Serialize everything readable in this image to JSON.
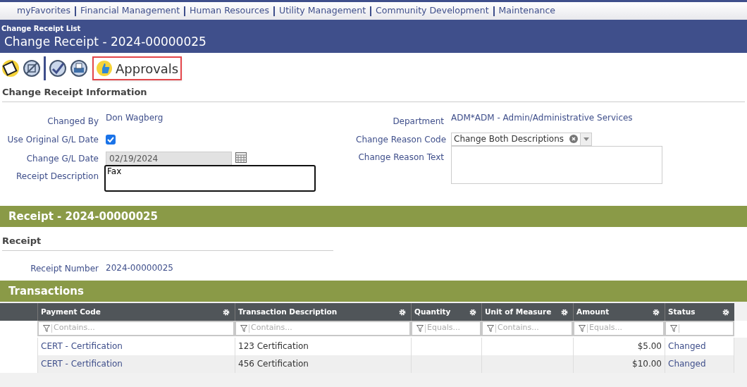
{
  "nav": [
    {
      "label": "myFavorites"
    },
    {
      "label": "Financial Management"
    },
    {
      "label": "Human Resources"
    },
    {
      "label": "Utility Management"
    },
    {
      "label": "Community Development"
    },
    {
      "label": "Maintenance"
    }
  ],
  "header": {
    "breadcrumb": "Change Receipt List",
    "title": "Change Receipt - 2024-00000025"
  },
  "toolbar": {
    "approvals_label": "Approvals"
  },
  "info": {
    "title": "Change Receipt Information",
    "changed_by": {
      "label": "Changed By",
      "value": "Don Wagberg"
    },
    "use_original_gl_date": {
      "label": "Use Original G/L Date",
      "checked": true
    },
    "change_gl_date": {
      "label": "Change G/L Date",
      "value": "02/19/2024",
      "disabled": true
    },
    "receipt_description": {
      "label": "Receipt Description",
      "value": "Fax"
    },
    "department": {
      "label": "Department",
      "value": "ADM*ADM - Admin/Administrative Services"
    },
    "change_reason_code": {
      "label": "Change Reason Code",
      "value": "Change Both Descriptions"
    },
    "change_reason_text": {
      "label": "Change Reason Text"
    }
  },
  "receipt_band": "Receipt - 2024-00000025",
  "receipt": {
    "title": "Receipt",
    "label": "Receipt Number",
    "value": "2024-00000025"
  },
  "transactions": {
    "title": "Transactions",
    "columns": [
      {
        "label": "Payment Code",
        "filter": "Contains..."
      },
      {
        "label": "Transaction Description",
        "filter": "Contains..."
      },
      {
        "label": "Quantity",
        "filter": "Equals..."
      },
      {
        "label": "Unit of Measure",
        "filter": "Contains..."
      },
      {
        "label": "Amount",
        "filter": "Equals..."
      },
      {
        "label": "Status"
      }
    ],
    "rows": [
      [
        "CERT - Certification",
        "123 Certification",
        "",
        "",
        "$5.00",
        "Changed"
      ],
      [
        "CERT - Certification",
        "456 Certification",
        "",
        "",
        "$10.00",
        "Changed"
      ]
    ]
  }
}
